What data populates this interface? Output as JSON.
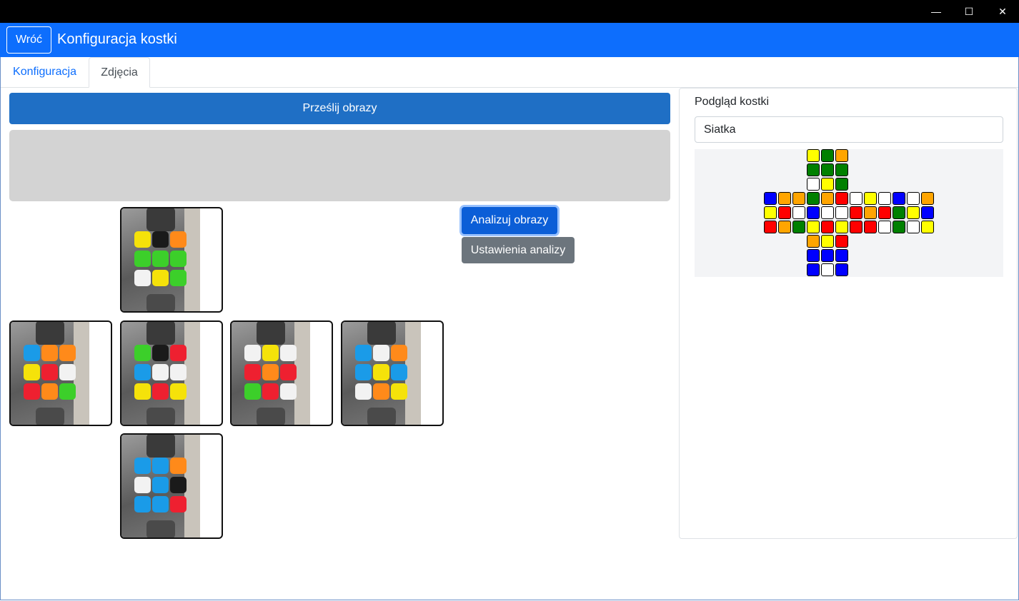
{
  "window": {
    "minimize_glyph": "—",
    "maximize_glyph": "☐",
    "close_glyph": "✕"
  },
  "header": {
    "back_label": "Wróć",
    "title": "Konfiguracja kostki"
  },
  "tabs": [
    {
      "label": "Konfiguracja",
      "active": false
    },
    {
      "label": "Zdjęcia",
      "active": true
    }
  ],
  "actions": {
    "upload_label": "Prześlij obrazy",
    "analyze_label": "Analizuj obrazy",
    "settings_label": "Ustawienia analizy"
  },
  "preview": {
    "label": "Podgląd kostki",
    "view_mode": "Siatka"
  },
  "colors": {
    "accent": "#0d6efd",
    "upload": "#1f6fc5",
    "secondary": "#6c757d",
    "W": "#ffffff",
    "Y": "#ffff00",
    "G": "#008000",
    "O": "#ffa500",
    "R": "#ff0000",
    "B": "#0000ff"
  },
  "cube_net": {
    "up": [
      "YGO",
      "GGG",
      "WYG"
    ],
    "left": [
      "BOO",
      "YRW",
      "ROG"
    ],
    "front": [
      "GOR",
      "BWW",
      "YRY"
    ],
    "right": [
      "WYW",
      "ROR",
      "RRW"
    ],
    "back": [
      "BWO",
      "GYB",
      "GWY"
    ],
    "down": [
      "OYR",
      "BBB",
      "BWB"
    ]
  },
  "photos": [
    {
      "label": "top",
      "stickers": [
        "Y",
        "k",
        "O",
        "G",
        "G",
        "G",
        "W",
        "Y",
        "G"
      ]
    },
    {
      "label": "left",
      "stickers": [
        "B",
        "O",
        "O",
        "Y",
        "R",
        "W",
        "R",
        "O",
        "G"
      ]
    },
    {
      "label": "front",
      "stickers": [
        "G",
        "k",
        "R",
        "B",
        "W",
        "W",
        "Y",
        "R",
        "Y"
      ]
    },
    {
      "label": "right",
      "stickers": [
        "W",
        "Y",
        "W",
        "R",
        "O",
        "R",
        "G",
        "R",
        "W"
      ]
    },
    {
      "label": "back",
      "stickers": [
        "B",
        "W",
        "O",
        "B",
        "Y",
        "B",
        "W",
        "O",
        "Y"
      ]
    },
    {
      "label": "bottom",
      "stickers": [
        "B",
        "B",
        "O",
        "W",
        "B",
        "k",
        "B",
        "B",
        "R"
      ]
    }
  ]
}
